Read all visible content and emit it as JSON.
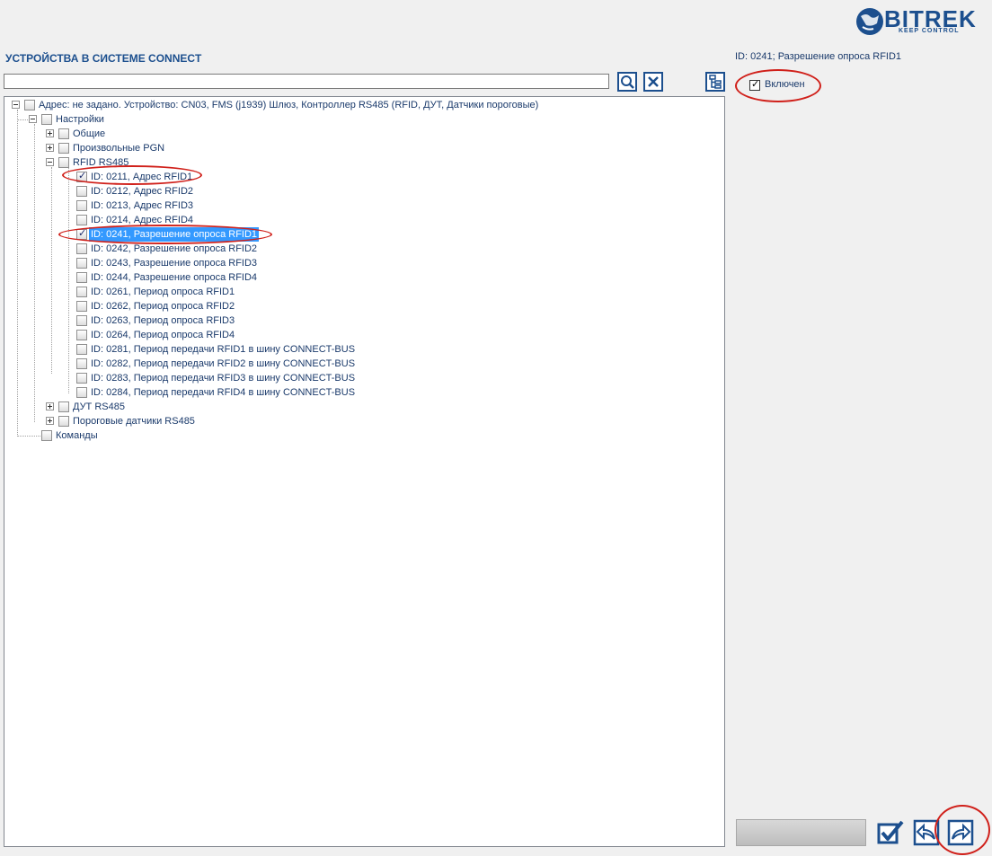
{
  "brand": {
    "name": "BITREK",
    "tagline": "KEEP CONTROL",
    "color": "#1c4f8e"
  },
  "title": "УСТРОЙСТВА В СИСТЕМЕ CONNECT",
  "search": {
    "value": "",
    "placeholder": ""
  },
  "toolbar": {
    "search_icon": "search-icon",
    "clear_icon": "close-icon",
    "tree_icon": "tree-view-icon"
  },
  "tree": {
    "root": "Адрес: не задано. Устройство: CN03, FMS (j1939) Шлюз, Контроллер RS485 (RFID, ДУТ, Датчики пороговые)",
    "settings": "Настройки",
    "general": "Общие",
    "pgn": "Произвольные PGN",
    "rfid": "RFID RS485",
    "rfid_items": [
      "ID: 0211, Адрес RFID1",
      "ID: 0212, Адрес RFID2",
      "ID: 0213, Адрес RFID3",
      "ID: 0214, Адрес RFID4",
      "ID: 0241, Разрешение опроса RFID1",
      "ID: 0242, Разрешение опроса RFID2",
      "ID: 0243, Разрешение опроса RFID3",
      "ID: 0244, Разрешение опроса RFID4",
      "ID: 0261, Период опроса RFID1",
      "ID: 0262, Период опроса RFID2",
      "ID: 0263, Период опроса RFID3",
      "ID: 0264, Период опроса RFID4",
      "ID: 0281, Период передачи RFID1 в шину CONNECT-BUS",
      "ID: 0282, Период передачи RFID2 в шину CONNECT-BUS",
      "ID: 0283, Период передачи RFID3 в шину CONNECT-BUS",
      "ID: 0284, Период передачи RFID4 в шину CONNECT-BUS"
    ],
    "fuel": "ДУТ RS485",
    "threshold": "Пороговые датчики RS485",
    "commands": "Команды"
  },
  "detail": {
    "title": "ID: 0241; Разрешение опроса RFID1",
    "enabled_label": "Включен",
    "enabled": true
  },
  "actions": {
    "apply_icon": "check-icon",
    "back_icon": "reply-icon",
    "forward_icon": "forward-icon"
  },
  "colors": {
    "selection": "#3399ff",
    "annotation": "#d0201a",
    "accent": "#1c4f8e"
  }
}
